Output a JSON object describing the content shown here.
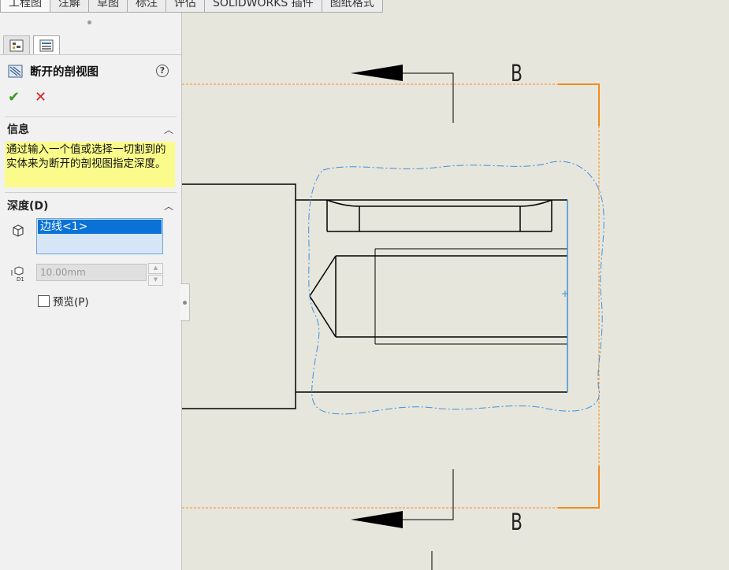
{
  "tabs": [
    {
      "label": "工程图",
      "active": true
    },
    {
      "label": "注解",
      "active": false
    },
    {
      "label": "草图",
      "active": false
    },
    {
      "label": "标注",
      "active": false
    },
    {
      "label": "评估",
      "active": false
    },
    {
      "label": "SOLIDWORKS 插件",
      "active": false
    },
    {
      "label": "图纸格式",
      "active": false
    }
  ],
  "property_manager": {
    "title": "断开的剖视图",
    "help_symbol": "?",
    "ok_symbol": "✔",
    "cancel_symbol": "✕",
    "info": {
      "header": "信息",
      "message": "通过输入一个值或选择一切割到的实体来为断开的剖视图指定深度。"
    },
    "depth": {
      "header": "深度(D)",
      "selected_edge": "边线<1>",
      "depth_value": "10.00mm",
      "depth_icon_label": "D1",
      "preview_label": "预览(P)",
      "preview_checked": false
    }
  },
  "drawing": {
    "section_label_top": "B",
    "section_label_bottom": "B"
  },
  "colors": {
    "panel_bg": "#f1f1f1",
    "canvas_bg": "#e7e6dc",
    "info_bg": "#fafb8a",
    "selection_blue": "#0a72d6",
    "section_orange": "#f08c1e",
    "spline_blue": "#3f8fe0",
    "ok_green": "#3c9a2a",
    "cancel_red": "#d32222"
  }
}
